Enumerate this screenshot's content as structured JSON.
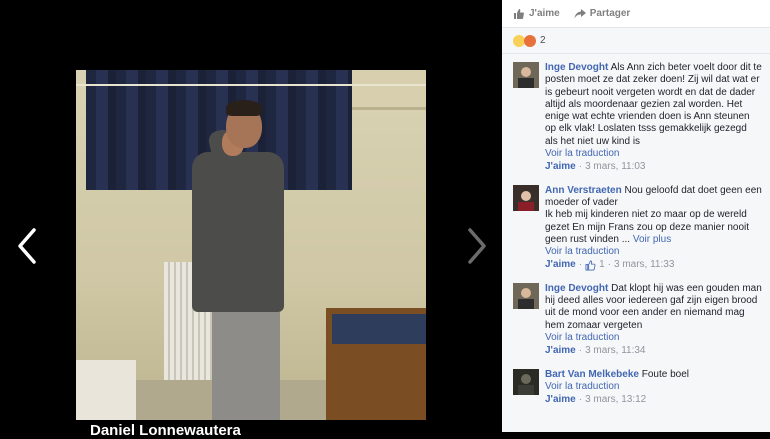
{
  "photo": {
    "caption": "Daniel Lonnewautera"
  },
  "actions": {
    "like": "J'aime",
    "share": "Partager"
  },
  "reactions": {
    "count": "2"
  },
  "comments": [
    {
      "author": "Inge Devoght",
      "text": "Als Ann zich beter voelt door dit te posten moet ze dat zeker doen! Zij wil dat wat er is gebeurt nooit vergeten wordt en dat de dader altijd als moordenaar gezien zal worden. Het enige wat echte vrienden doen is Ann steunen op elk vlak! Loslaten tsss gemakkelijk gezegd als het niet uw kind is",
      "translate": "Voir la traduction",
      "like": "J'aime",
      "time": "3 mars, 11:03"
    },
    {
      "author": "Ann Verstraeten",
      "text": "Nou geloofd dat doet geen een moeder of vader",
      "text2": "Ik heb mij kinderen niet zo maar op de wereld gezet En mijn Frans zou op deze manier nooit geen rust vinden ...",
      "more": "Voir plus",
      "translate": "Voir la traduction",
      "like": "J'aime",
      "likes_count": "1",
      "time": "3 mars, 11:33"
    },
    {
      "author": "Inge Devoght",
      "text": "Dat klopt hij was een gouden man hij deed alles voor iedereen gaf zijn eigen brood uit de mond voor een ander en niemand mag hem zomaar vergeten",
      "translate": "Voir la traduction",
      "like": "J'aime",
      "time": "3 mars, 11:34"
    },
    {
      "author": "Bart Van Melkebeke",
      "text": "Foute boel",
      "translate": "Voir la traduction",
      "like": "J'aime",
      "time": "3 mars, 13:12"
    }
  ],
  "colors": {
    "link": "#4267b2",
    "muted": "#90949c",
    "panel_bg": "#f6f7f9"
  }
}
